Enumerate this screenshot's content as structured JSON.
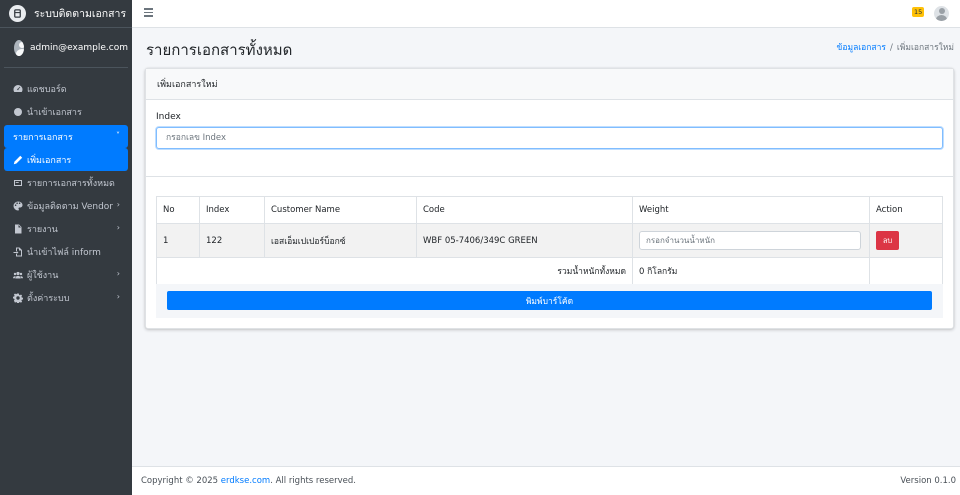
{
  "brand": {
    "title": "ระบบติดตามเอกสาร",
    "icon": "logo-icon"
  },
  "user": {
    "email": "admin@example.com"
  },
  "sidebar": {
    "items": [
      {
        "label": "แดชบอร์ด",
        "icon": "dashboard-icon"
      },
      {
        "label": "นำเข้าเอกสาร",
        "icon": "circle-icon"
      },
      {
        "label": "รายการเอกสาร",
        "icon": "",
        "chevron": "˅"
      },
      {
        "label": "เพิ่มเอกสาร",
        "icon": "pencil-icon"
      },
      {
        "label": "รายการเอกสารทั้งหมด",
        "icon": "list-icon"
      },
      {
        "label": "ข้อมูลติดตาม Vendor",
        "icon": "palette-icon",
        "chevron": "›"
      },
      {
        "label": "รายงาน",
        "icon": "report-icon",
        "chevron": "›"
      },
      {
        "label": "นำเข้าไฟล์ inform",
        "icon": "file-import-icon"
      },
      {
        "label": "ผู้ใช้งาน",
        "icon": "users-icon",
        "chevron": "›"
      },
      {
        "label": "ตั้งค่าระบบ",
        "icon": "gear-icon",
        "chevron": "›"
      }
    ]
  },
  "topbar": {
    "notification_count": "15"
  },
  "header": {
    "title": "รายการเอกสารทั้งหมด",
    "breadcrumb_link": "ข้อมูลเอกสาร",
    "breadcrumb_sep": "/",
    "breadcrumb_current": "เพิ่มเอกสารใหม่"
  },
  "card": {
    "title": "เพิ่มเอกสารใหม่",
    "index_label": "Index",
    "index_placeholder": "กรอกเลข Index"
  },
  "table": {
    "headers": [
      "No",
      "Index",
      "Customer Name",
      "Code",
      "Weight",
      "Action"
    ],
    "rows": [
      {
        "no": "1",
        "index": "122",
        "customer": "เอสเอ็มเปเปอร์บ็อกซ์",
        "code": "WBF 05-7406/349C GREEN",
        "weight_placeholder": "กรอกจำนวนน้ำหนัก",
        "action": "ลบ"
      }
    ],
    "total_label": "รวมน้ำหนักทั้งหมด",
    "total_value": "0 กิโลกรัม"
  },
  "print_button": "พิมพ์บาร์โค้ด",
  "footer": {
    "copyright_prefix": "Copyright © 2025",
    "link": "erdkse.com",
    "suffix": ". All rights reserved.",
    "version": "Version 0.1.0"
  },
  "colors": {
    "primary": "#007bff",
    "danger": "#dc3545",
    "sidebar": "#343a40",
    "badge": "#ffc107"
  }
}
